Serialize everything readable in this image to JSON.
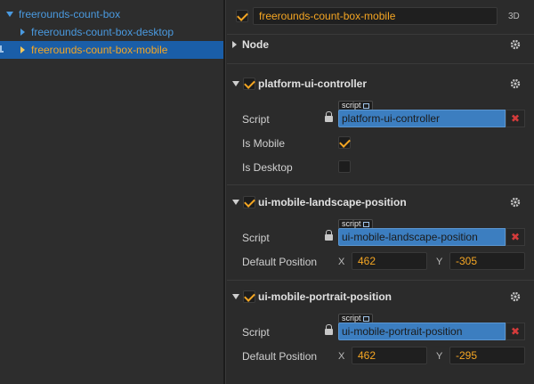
{
  "hierarchy": {
    "items": [
      {
        "label": "freerounds-count-box",
        "expanded": true,
        "selected": false
      },
      {
        "label": "freerounds-count-box-desktop",
        "expanded": false,
        "selected": false
      },
      {
        "label": "freerounds-count-box-mobile",
        "expanded": false,
        "selected": true
      }
    ]
  },
  "inspector": {
    "node_enabled": true,
    "node_name": "freerounds-count-box-mobile",
    "mode_badge": "3D",
    "node_section": {
      "title": "Node",
      "expanded": false
    },
    "components": [
      {
        "title": "platform-ui-controller",
        "enabled": true,
        "script_label": "Script",
        "script_tag": "script",
        "script_value": "platform-ui-controller",
        "props": [
          {
            "label": "Is Mobile",
            "checked": true
          },
          {
            "label": "Is Desktop",
            "checked": false
          }
        ]
      },
      {
        "title": "ui-mobile-landscape-position",
        "enabled": true,
        "script_label": "Script",
        "script_tag": "script",
        "script_value": "ui-mobile-landscape-position",
        "position_label": "Default Position",
        "x_label": "X",
        "x_value": "462",
        "y_label": "Y",
        "y_value": "-305"
      },
      {
        "title": "ui-mobile-portrait-position",
        "enabled": true,
        "script_label": "Script",
        "script_tag": "script",
        "script_value": "ui-mobile-portrait-position",
        "position_label": "Default Position",
        "x_label": "X",
        "x_value": "462",
        "y_label": "Y",
        "y_value": "-295"
      }
    ],
    "clear_glyph": "✖"
  },
  "colors": {
    "accent_orange": "#f5a623",
    "tree_blue": "#4a9ae0",
    "selection_blue": "#1a5ea8",
    "script_field_blue": "#3c7ec0",
    "clear_red": "#d43b3b"
  },
  "icons": {
    "expand": "chevron-down-icon",
    "collapse": "chevron-right-icon",
    "settings": "gear-icon",
    "lock": "lock-icon",
    "external": "external-link-icon",
    "clear": "close-icon"
  }
}
